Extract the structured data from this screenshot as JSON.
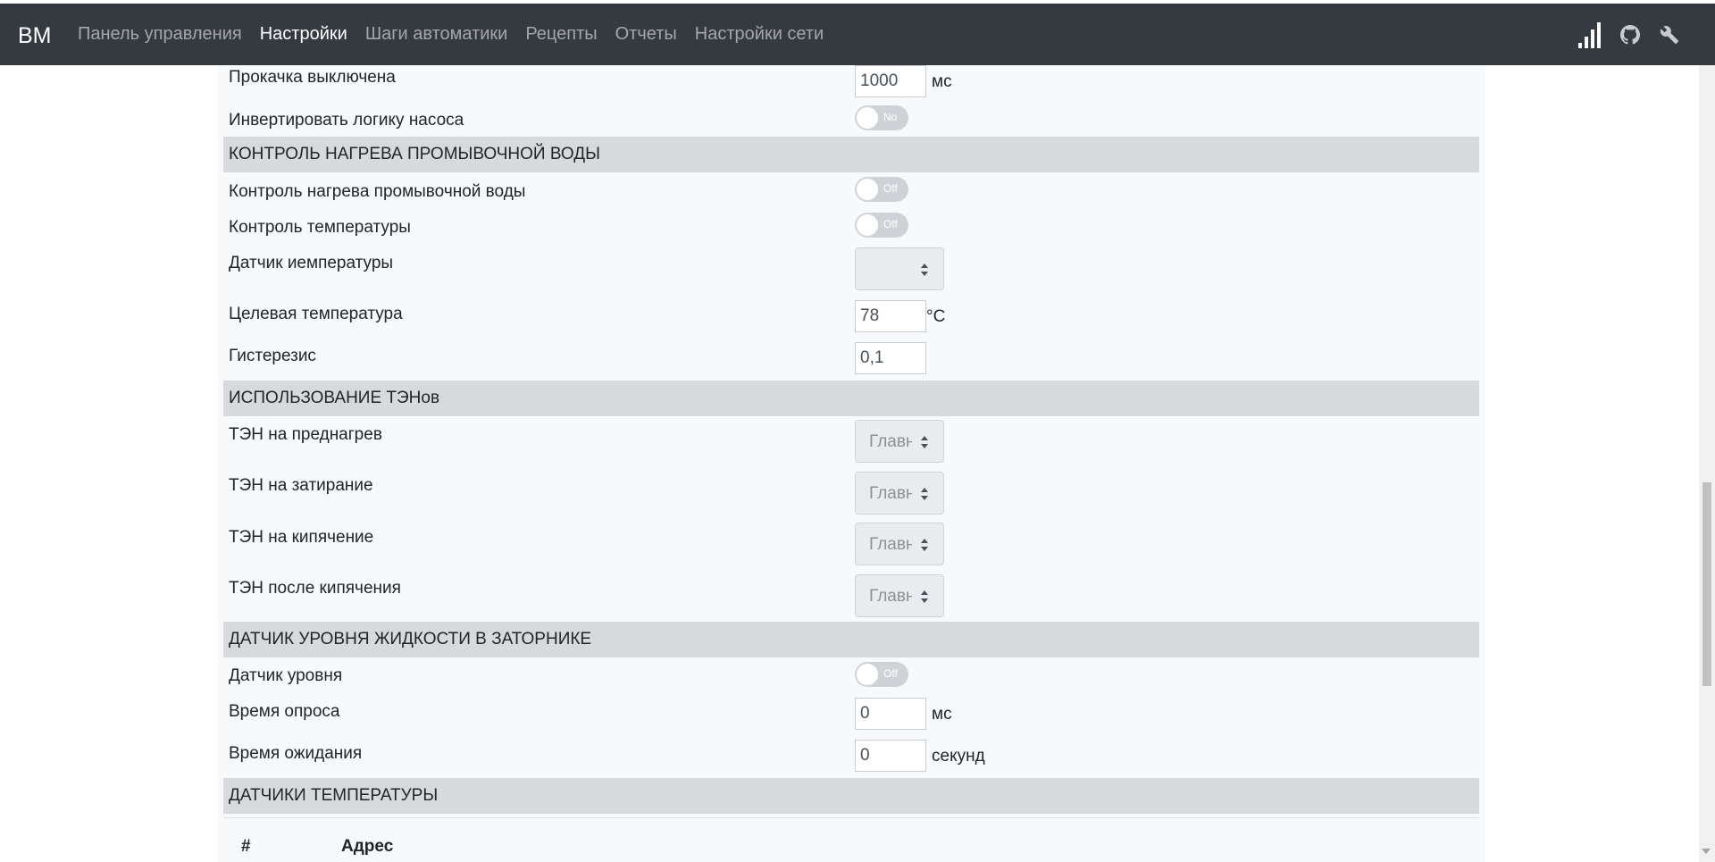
{
  "navbar": {
    "brand": "BM",
    "links": [
      {
        "label": "Панель управления",
        "active": false
      },
      {
        "label": "Настройки",
        "active": true
      },
      {
        "label": "Шаги автоматики",
        "active": false
      },
      {
        "label": "Рецепты",
        "active": false
      },
      {
        "label": "Отчеты",
        "active": false
      },
      {
        "label": "Настройки сети",
        "active": false
      }
    ],
    "icons": [
      "signal-icon",
      "github-icon",
      "wrench-icon"
    ]
  },
  "pump": {
    "off_label": "Прокачка выключена",
    "off_value": "1000",
    "off_unit": "мс",
    "invert_label": "Инвертировать логику насоса",
    "invert_toggle": "No"
  },
  "wash_heat": {
    "title": "КОНТРОЛЬ НАГРЕВА ПРОМЫВОЧНОЙ ВОДЫ",
    "control_label": "Контроль нагрева промывочной воды",
    "control_toggle": "Off",
    "temp_control_label": "Контроль температуры",
    "temp_control_toggle": "Off",
    "sensor_label": "Датчик иемпературы",
    "sensor_value": "",
    "target_label": "Целевая температура",
    "target_value": "78",
    "target_unit": "°C",
    "hysteresis_label": "Гистерезис",
    "hysteresis_value": "0,1"
  },
  "heaters": {
    "title": "ИСПОЛЬЗОВАНИЕ ТЭНов",
    "items": [
      {
        "label": "ТЭН на преднагрев",
        "value": "Главн"
      },
      {
        "label": "ТЭН на затирание",
        "value": "Главн"
      },
      {
        "label": "ТЭН на кипячение",
        "value": "Главн"
      },
      {
        "label": "ТЭН после кипячения",
        "value": "Главн"
      }
    ]
  },
  "level": {
    "title": "ДАТЧИК УРОВНЯ ЖИДКОСТИ В ЗАТОРНИКЕ",
    "sensor_label": "Датчик уровня",
    "sensor_toggle": "Off",
    "poll_label": "Время опроса",
    "poll_value": "0",
    "poll_unit": "мс",
    "wait_label": "Время ожидания",
    "wait_value": "0",
    "wait_unit": "секунд"
  },
  "temp_sensors": {
    "title": "ДАТЧИКИ ТЕМПЕРАТУРЫ",
    "columns": [
      "#",
      "Адрес"
    ]
  },
  "colors": {
    "navbar_bg": "#343a40",
    "section_bg": "#d7d9dc",
    "content_bg": "#f8f9fa",
    "toggle_off": "#cfd3d7"
  }
}
